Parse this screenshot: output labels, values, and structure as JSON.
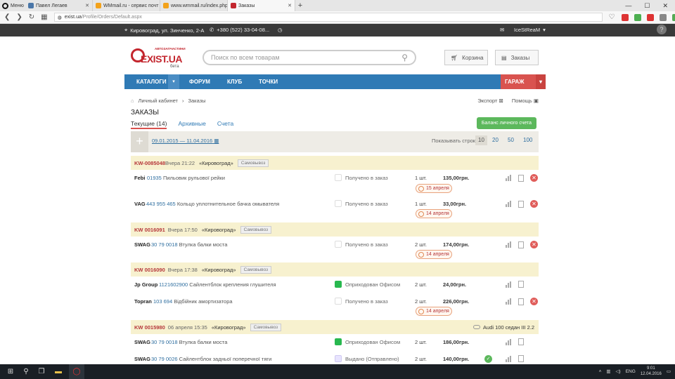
{
  "browser": {
    "menu_label": "Меню",
    "tabs": [
      {
        "title": "Павел Легаев",
        "color": "#4a76a8"
      },
      {
        "title": "WMmail.ru - сервис почт",
        "color": "#f3a21b"
      },
      {
        "title": "www.wmmail.ru/index.php",
        "color": "#f3a21b"
      },
      {
        "title": "Заказы",
        "color": "#c3262e"
      }
    ],
    "url_host": "exist.ua",
    "url_path": "/Profile/Orders/Default.aspx"
  },
  "topstrip": {
    "address": "Кировоград, ул. Зинченко, 2-А",
    "phone": "+380 (522) 33-04-08...",
    "username": "IceStReaM"
  },
  "header": {
    "logo": "EXIST.UA",
    "logo_sub": "АВТОЗАПЧАСТИНИ",
    "logo_beta": "бета",
    "search_placeholder": "Поиск по всем товарам",
    "cart_label": "Корзина",
    "orders_label": "Заказы"
  },
  "nav": {
    "items": [
      "КАТАЛОГИ",
      "ФОРУМ",
      "КЛУБ",
      "ТОЧКИ"
    ],
    "garage": "ГАРАЖ"
  },
  "page": {
    "breadcrumb": [
      "Личный кабинет",
      "Заказы"
    ],
    "export": "Экспорт",
    "help": "Помощь",
    "title": "ЗАКАЗЫ",
    "tabs": [
      "Текущие (14)",
      "Архивные",
      "Счета"
    ],
    "balance_btn": "Баланс личного счета",
    "date_range": "09.01.2015 — 11.04.2016",
    "show_rows_label": "Показывать строк",
    "page_sizes": [
      "10",
      "20",
      "50",
      "100"
    ]
  },
  "orders": [
    {
      "no": "KW-0085048",
      "date": "Вчера 21:22",
      "city": "«Кировоград»",
      "tag": "Самовывоз",
      "car": ""
    },
    {
      "no": "KW 0016091",
      "date": "Вчера 17:50",
      "city": "«Кировоград»",
      "tag": "Самовывоз",
      "car": ""
    },
    {
      "no": "KW 0016090",
      "date": "Вчера 17:38",
      "city": "«Кировоград»",
      "tag": "Самовывоз",
      "car": ""
    },
    {
      "no": "KW 0015980",
      "date": "06 апреля 15:35",
      "city": "«Кировоград»",
      "tag": "Самовывоз",
      "car": "Audi 100 седан III 2.2"
    }
  ],
  "rows": [
    {
      "brand": "Febi",
      "code": "01935",
      "name": "Пильовик рульової рейки",
      "status": "Получено в заказ",
      "qty": "1 шт.",
      "price": "135,00грн.",
      "eta": "15 апреля"
    },
    {
      "brand": "VAG",
      "code": "443 955 465",
      "name": "Кольцо уплотнительное бачка омывателя",
      "status": "Получено в заказ",
      "qty": "1 шт.",
      "price": "33,00грн.",
      "eta": "14 апреля"
    },
    {
      "brand": "SWAG",
      "code": "30 79 0018",
      "name": "Втулка балки моста",
      "status": "Получено в заказ",
      "qty": "2 шт.",
      "price": "174,00грн.",
      "eta": "14 апреля"
    },
    {
      "brand": "Jp Group",
      "code": "1121602900",
      "name": "Сайлентблок крепления глушителя",
      "status": "Оприходован Офисом",
      "qty": "2 шт.",
      "price": "24,00грн.",
      "eta": ""
    },
    {
      "brand": "Topran",
      "code": "103 694",
      "name": "Відбійник амортизатора",
      "status": "Получено в заказ",
      "qty": "2 шт.",
      "price": "226,00грн.",
      "eta": "14 апреля"
    },
    {
      "brand": "SWAG",
      "code": "30 79 0018",
      "name": "Втулка балки моста",
      "status": "Оприходован Офисом",
      "qty": "2 шт.",
      "price": "186,00грн.",
      "eta": ""
    },
    {
      "brand": "SWAG",
      "code": "30 79 0026",
      "name": "Сайлентблок задньої поперечної тяги",
      "status": "Выдано (Отправлено)",
      "qty": "2 шт.",
      "price": "140,00грн.",
      "eta": ""
    }
  ],
  "taskbar": {
    "lang": "ENG",
    "time": "9:01",
    "date": "12.04.2016"
  },
  "colors": {
    "accent": "#2f7ab5",
    "brand_red": "#c3262e",
    "order_header": "#f7f1cf",
    "green": "#5cb85c"
  }
}
